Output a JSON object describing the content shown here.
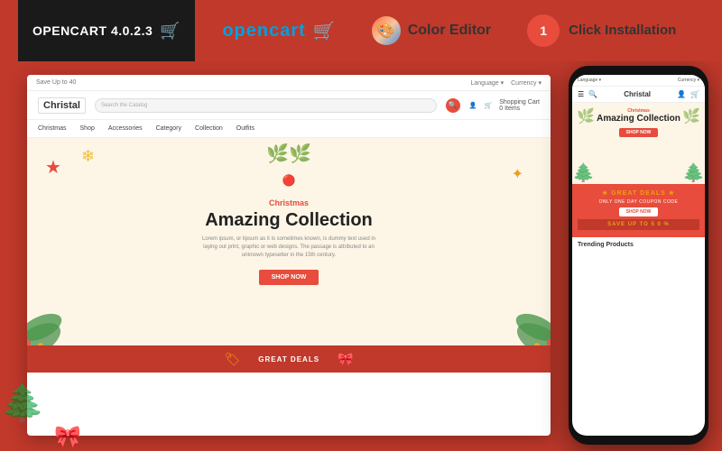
{
  "topbar": {
    "version": "OPENCART 4.0.2.3",
    "opencart_label": "opencart",
    "color_editor_label": "Color Editor",
    "one_click_label": "1",
    "one_click_sub": "Click\nInstallation",
    "one_click_full": "Click Installation"
  },
  "website": {
    "topbar_text": "Save Up to 40",
    "language": "Language",
    "currency": "Currency",
    "logo": "Christal",
    "search_placeholder": "Search the Catalog",
    "shopping_cart": "Shopping Cart",
    "cart_items": "0 Items",
    "nav_items": [
      "Christmas",
      "Shop",
      "Accessories",
      "Category",
      "Collection",
      "Outfits"
    ],
    "hero_subtitle": "Christmas",
    "hero_title": "Amazing Collection",
    "hero_desc": "Lorem ipsum, or lipsum as it is sometimes known, is dummy text used in laying out print, graphic or web designs. The passage is attributed to an unknown typesetter in the 15th century.",
    "shop_now": "SHOP NOW",
    "great_deals": "GREAT DEALS"
  },
  "mobile": {
    "language": "Language",
    "currency": "Currency",
    "logo": "Christal",
    "hero_subtitle": "Christmas",
    "hero_title": "Amazing Collection",
    "shop_now": "SHOP NOW",
    "deals_title": "★ GREAT DEALS ★",
    "deals_sub": "ONLY ONE DAY COUPON CODE",
    "deals_btn": "SHOP NOW",
    "deals_save": "SAVE UP TO 5 0 %",
    "trending": "Trending Products"
  },
  "icons": {
    "cart": "🛒",
    "search": "🔍",
    "user": "👤",
    "snowflake": "❄",
    "star": "★",
    "pine": "🌲",
    "ribbon": "🎀",
    "tag": "🏷"
  }
}
